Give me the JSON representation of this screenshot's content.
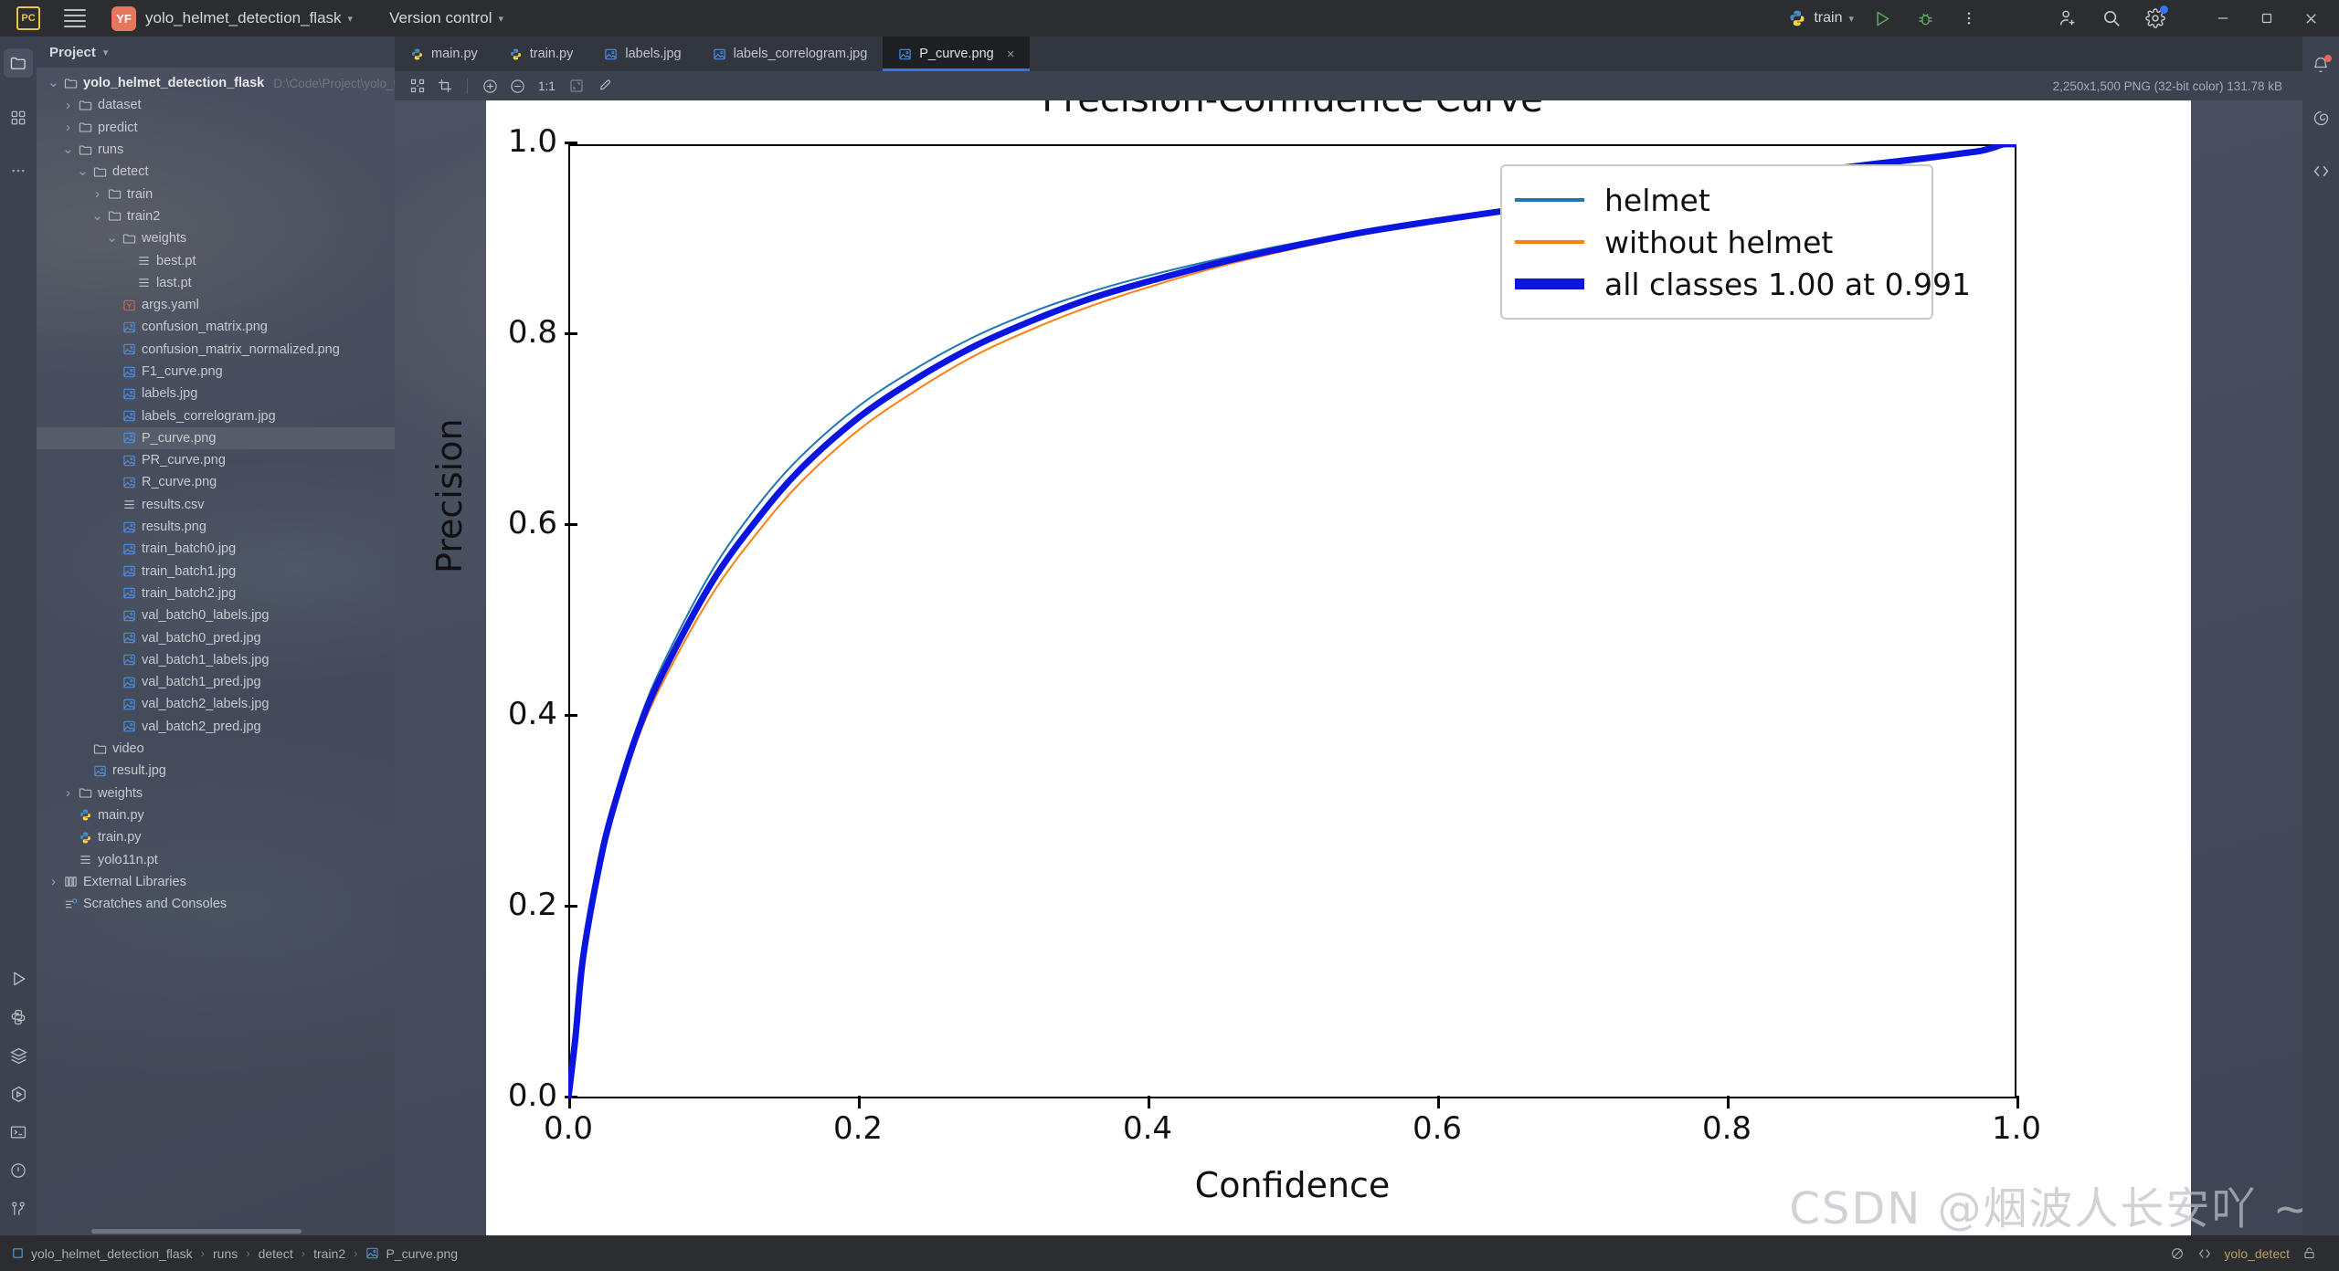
{
  "titlebar": {
    "ide_badge": "PC",
    "project_badge": "YF",
    "project_name": "yolo_helmet_detection_flask",
    "version_control": "Version control",
    "run_config": "train",
    "icons": [
      "hamburger-icon",
      "run-icon",
      "debug-icon",
      "more-icon",
      "add-user-icon",
      "search-icon",
      "settings-icon",
      "minimize-icon",
      "maximize-icon",
      "close-icon"
    ]
  },
  "left_rail": {
    "top_icons": [
      "project-folder-icon",
      "structure-icon",
      "more-tool-windows-icon"
    ],
    "bottom_icons": [
      "run-icon",
      "python-console-icon",
      "services-icon",
      "profiler-icon",
      "terminal-icon",
      "problems-icon",
      "version-control-icon"
    ]
  },
  "right_rail": {
    "icons": [
      "notifications-icon",
      "ai-assistant-icon",
      "code-with-me-icon"
    ]
  },
  "project_panel": {
    "title": "Project",
    "tree": [
      {
        "depth": 0,
        "arrow": "down",
        "icon": "folder-icon",
        "label": "yolo_helmet_detection_flask",
        "path": "D:\\Code\\Project\\yolo_target",
        "root": true
      },
      {
        "depth": 1,
        "arrow": "right",
        "icon": "folder-icon",
        "label": "dataset"
      },
      {
        "depth": 1,
        "arrow": "right",
        "icon": "folder-icon",
        "label": "predict"
      },
      {
        "depth": 1,
        "arrow": "down",
        "icon": "folder-icon",
        "label": "runs"
      },
      {
        "depth": 2,
        "arrow": "down",
        "icon": "folder-icon",
        "label": "detect"
      },
      {
        "depth": 3,
        "arrow": "right",
        "icon": "folder-icon",
        "label": "train"
      },
      {
        "depth": 3,
        "arrow": "down",
        "icon": "folder-icon",
        "label": "train2"
      },
      {
        "depth": 4,
        "arrow": "down",
        "icon": "folder-icon",
        "label": "weights"
      },
      {
        "depth": 5,
        "arrow": "none",
        "icon": "file-text-icon",
        "label": "best.pt"
      },
      {
        "depth": 5,
        "arrow": "none",
        "icon": "file-text-icon",
        "label": "last.pt"
      },
      {
        "depth": 4,
        "arrow": "none",
        "icon": "yaml-icon",
        "label": "args.yaml"
      },
      {
        "depth": 4,
        "arrow": "none",
        "icon": "image-file-icon",
        "label": "confusion_matrix.png"
      },
      {
        "depth": 4,
        "arrow": "none",
        "icon": "image-file-icon",
        "label": "confusion_matrix_normalized.png"
      },
      {
        "depth": 4,
        "arrow": "none",
        "icon": "image-file-icon",
        "label": "F1_curve.png"
      },
      {
        "depth": 4,
        "arrow": "none",
        "icon": "image-file-icon",
        "label": "labels.jpg"
      },
      {
        "depth": 4,
        "arrow": "none",
        "icon": "image-file-icon",
        "label": "labels_correlogram.jpg"
      },
      {
        "depth": 4,
        "arrow": "none",
        "icon": "image-file-icon",
        "label": "P_curve.png",
        "selected": true
      },
      {
        "depth": 4,
        "arrow": "none",
        "icon": "image-file-icon",
        "label": "PR_curve.png"
      },
      {
        "depth": 4,
        "arrow": "none",
        "icon": "image-file-icon",
        "label": "R_curve.png"
      },
      {
        "depth": 4,
        "arrow": "none",
        "icon": "file-text-icon",
        "label": "results.csv"
      },
      {
        "depth": 4,
        "arrow": "none",
        "icon": "image-file-icon",
        "label": "results.png"
      },
      {
        "depth": 4,
        "arrow": "none",
        "icon": "image-file-icon",
        "label": "train_batch0.jpg"
      },
      {
        "depth": 4,
        "arrow": "none",
        "icon": "image-file-icon",
        "label": "train_batch1.jpg"
      },
      {
        "depth": 4,
        "arrow": "none",
        "icon": "image-file-icon",
        "label": "train_batch2.jpg"
      },
      {
        "depth": 4,
        "arrow": "none",
        "icon": "image-file-icon",
        "label": "val_batch0_labels.jpg"
      },
      {
        "depth": 4,
        "arrow": "none",
        "icon": "image-file-icon",
        "label": "val_batch0_pred.jpg"
      },
      {
        "depth": 4,
        "arrow": "none",
        "icon": "image-file-icon",
        "label": "val_batch1_labels.jpg"
      },
      {
        "depth": 4,
        "arrow": "none",
        "icon": "image-file-icon",
        "label": "val_batch1_pred.jpg"
      },
      {
        "depth": 4,
        "arrow": "none",
        "icon": "image-file-icon",
        "label": "val_batch2_labels.jpg"
      },
      {
        "depth": 4,
        "arrow": "none",
        "icon": "image-file-icon",
        "label": "val_batch2_pred.jpg"
      },
      {
        "depth": 2,
        "arrow": "none",
        "icon": "folder-icon",
        "label": "video"
      },
      {
        "depth": 2,
        "arrow": "none",
        "icon": "image-file-icon",
        "label": "result.jpg"
      },
      {
        "depth": 1,
        "arrow": "right",
        "icon": "folder-icon",
        "label": "weights"
      },
      {
        "depth": 1,
        "arrow": "none",
        "icon": "python-icon",
        "label": "main.py"
      },
      {
        "depth": 1,
        "arrow": "none",
        "icon": "python-icon",
        "label": "train.py"
      },
      {
        "depth": 1,
        "arrow": "none",
        "icon": "file-text-icon",
        "label": "yolo11n.pt"
      },
      {
        "depth": 0,
        "arrow": "right",
        "icon": "library-icon",
        "label": "External Libraries"
      },
      {
        "depth": 0,
        "arrow": "none",
        "icon": "scratches-icon",
        "label": "Scratches and Consoles"
      }
    ]
  },
  "editor": {
    "tabs": [
      {
        "label": "main.py",
        "icon": "python-icon",
        "active": false
      },
      {
        "label": "train.py",
        "icon": "python-icon",
        "active": false
      },
      {
        "label": "labels.jpg",
        "icon": "image-file-icon",
        "active": false
      },
      {
        "label": "labels_correlogram.jpg",
        "icon": "image-file-icon",
        "active": false
      },
      {
        "label": "P_curve.png",
        "icon": "image-file-icon",
        "active": true
      }
    ],
    "image_toolbar": {
      "zoom_ratio": "1:1",
      "icons": [
        "transparency-grid-icon",
        "crop-icon",
        "zoom-in-icon",
        "zoom-out-icon",
        "fit-to-window-icon",
        "color-picker-icon"
      ]
    },
    "image_info": "2,250x1,500 PNG (32-bit color) 131.78 kB"
  },
  "chart_data": {
    "type": "line",
    "title": "Precision-Confidence Curve",
    "xlabel": "Confidence",
    "ylabel": "Precision",
    "xlim": [
      0.0,
      1.0
    ],
    "ylim": [
      0.0,
      1.0
    ],
    "xticks": [
      "0.0",
      "0.2",
      "0.4",
      "0.6",
      "0.8",
      "1.0"
    ],
    "yticks": [
      "0.0",
      "0.2",
      "0.4",
      "0.6",
      "0.8",
      "1.0"
    ],
    "grid": false,
    "legend_position": "upper right",
    "colors": {
      "helmet": "#1f77b4",
      "without_helmet": "#ff7f0e",
      "all_classes": "#0b15e0"
    },
    "series": [
      {
        "name": "helmet",
        "color": "#1f77b4",
        "linewidth": 2,
        "x": [
          0.0,
          0.005,
          0.01,
          0.02,
          0.03,
          0.05,
          0.07,
          0.1,
          0.13,
          0.16,
          0.2,
          0.24,
          0.28,
          0.32,
          0.36,
          0.4,
          0.45,
          0.5,
          0.55,
          0.6,
          0.65,
          0.7,
          0.75,
          0.8,
          0.85,
          0.9,
          0.94,
          0.96,
          0.975,
          0.985,
          0.991,
          1.0
        ],
        "y": [
          0.0,
          0.06,
          0.14,
          0.23,
          0.3,
          0.4,
          0.47,
          0.555,
          0.62,
          0.672,
          0.725,
          0.765,
          0.798,
          0.824,
          0.845,
          0.862,
          0.88,
          0.896,
          0.909,
          0.92,
          0.93,
          0.94,
          0.949,
          0.958,
          0.967,
          0.976,
          0.984,
          0.988,
          0.992,
          0.996,
          0.998,
          1.0
        ]
      },
      {
        "name": "without helmet",
        "color": "#ff7f0e",
        "linewidth": 2,
        "x": [
          0.0,
          0.005,
          0.01,
          0.02,
          0.03,
          0.05,
          0.07,
          0.1,
          0.13,
          0.16,
          0.2,
          0.24,
          0.28,
          0.32,
          0.36,
          0.4,
          0.45,
          0.5,
          0.55,
          0.6,
          0.65,
          0.7,
          0.75,
          0.8,
          0.85,
          0.9,
          0.94,
          0.96,
          0.975,
          0.985,
          0.991,
          1.0
        ],
        "y": [
          0.0,
          0.07,
          0.15,
          0.235,
          0.295,
          0.385,
          0.45,
          0.53,
          0.592,
          0.645,
          0.7,
          0.742,
          0.778,
          0.806,
          0.83,
          0.85,
          0.872,
          0.89,
          0.906,
          0.92,
          0.932,
          0.944,
          0.954,
          0.964,
          0.973,
          0.981,
          0.988,
          0.991,
          0.994,
          0.997,
          0.999,
          1.0
        ]
      },
      {
        "name": "all classes 1.00 at 0.991",
        "color": "#0b15e0",
        "linewidth": 7,
        "x": [
          0.0,
          0.005,
          0.01,
          0.02,
          0.03,
          0.05,
          0.07,
          0.1,
          0.13,
          0.16,
          0.2,
          0.24,
          0.28,
          0.32,
          0.36,
          0.4,
          0.45,
          0.5,
          0.55,
          0.6,
          0.65,
          0.7,
          0.75,
          0.8,
          0.85,
          0.9,
          0.94,
          0.96,
          0.975,
          0.985,
          0.991,
          1.0
        ],
        "y": [
          0.0,
          0.065,
          0.145,
          0.233,
          0.298,
          0.393,
          0.46,
          0.543,
          0.606,
          0.659,
          0.713,
          0.754,
          0.788,
          0.815,
          0.838,
          0.856,
          0.876,
          0.893,
          0.908,
          0.92,
          0.931,
          0.942,
          0.952,
          0.961,
          0.97,
          0.979,
          0.986,
          0.99,
          0.993,
          0.997,
          1.0,
          1.0
        ]
      }
    ],
    "legend": [
      {
        "label": "helmet",
        "color": "#1f77b4",
        "thick": false
      },
      {
        "label": "without helmet",
        "color": "#ff7f0e",
        "thick": false
      },
      {
        "label": "all classes 1.00 at 0.991",
        "color": "#0b15e0",
        "thick": true
      }
    ]
  },
  "watermark": "CSDN @烟波人长安吖 ~",
  "status_bar": {
    "breadcrumbs": [
      "yolo_helmet_detection_flask",
      "runs",
      "detect",
      "train2",
      "P_curve.png"
    ],
    "breadcrumb_leaf_icon": "image-file-icon",
    "interpreter": "yolo_detect",
    "right_icons": [
      "inspections-icon",
      "code-with-me-icon",
      "lock-icon"
    ]
  }
}
